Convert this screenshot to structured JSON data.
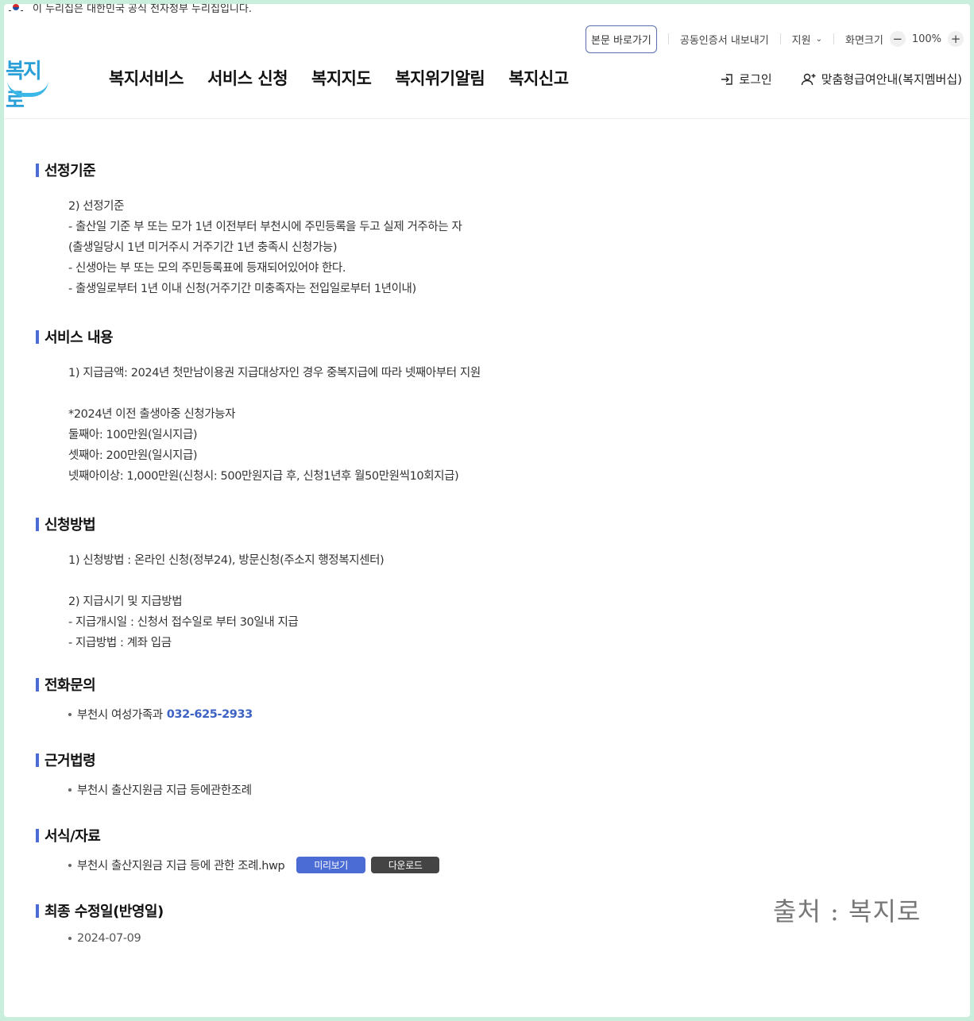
{
  "gov_banner": {
    "text": "이 누리집은 대한민국 공식 전자정부 누리집입니다."
  },
  "utility": {
    "skip_link": "본문 바로가기",
    "cert_export": "공동인증서 내보내기",
    "support": "지원",
    "screen_size": "화면크기",
    "zoom_level": "100%"
  },
  "logo": {
    "text": "복지로"
  },
  "gnb": [
    {
      "label": "복지서비스"
    },
    {
      "label": "서비스 신청"
    },
    {
      "label": "복지지도"
    },
    {
      "label": "복지위기알림"
    },
    {
      "label": "복지신고"
    }
  ],
  "header_right": {
    "login": "로그인",
    "membership": "맞춤형급여안내(복지멤버십)"
  },
  "sections": {
    "criteria": {
      "title": "선정기준",
      "lines": [
        "2) 선정기준",
        "- 출산일 기준 부 또는 모가 1년 이전부터 부천시에 주민등록을 두고 실제 거주하는 자",
        "(출생일당시 1년 미거주시 거주기간 1년 충족시 신청가능)",
        "- 신생아는 부 또는 모의 주민등록표에 등재되어있어야 한다.",
        "- 출생일로부터 1년 이내 신청(거주기간 미충족자는 전입일로부터 1년이내)"
      ]
    },
    "service": {
      "title": "서비스 내용",
      "line1": "1) 지급금액: 2024년 첫만남이용권 지급대상자인 경우 중복지급에 따라 넷째아부터 지원",
      "lines": [
        "*2024년 이전 출생아중 신청가능자",
        "둘째아: 100만원(일시지급)",
        "셋째아: 200만원(일시지급)",
        "넷째아이상: 1,000만원(신청시: 500만원지급 후, 신청1년후 월50만원씩10회지급)"
      ]
    },
    "method": {
      "title": "신청방법",
      "line1": "1) 신청방법 : 온라인 신청(정부24), 방문신청(주소지 행정복지센터)",
      "lines": [
        "2) 지급시기 및 지급방법",
        "- 지급개시일 : 신청서 접수일로 부터 30일내 지급",
        "- 지급방법 : 계좌 입금"
      ]
    },
    "contact": {
      "title": "전화문의",
      "dept": "부천시 여성가족과",
      "phone": "032-625-2933"
    },
    "law": {
      "title": "근거법령",
      "item": "부천시 출산지원금 지급 등에관한조례"
    },
    "forms": {
      "title": "서식/자료",
      "file": "부천시 출산지원금 지급 등에 관한 조례.hwp",
      "preview": "미리보기",
      "download": "다운로드"
    },
    "updated": {
      "title": "최종 수정일(반영일)",
      "date": "2024-07-09"
    }
  },
  "watermark": "출처 : 복지로",
  "colors": {
    "accent": "#4a6cd4",
    "phone": "#3b62c4",
    "background": "#c9efdc"
  }
}
